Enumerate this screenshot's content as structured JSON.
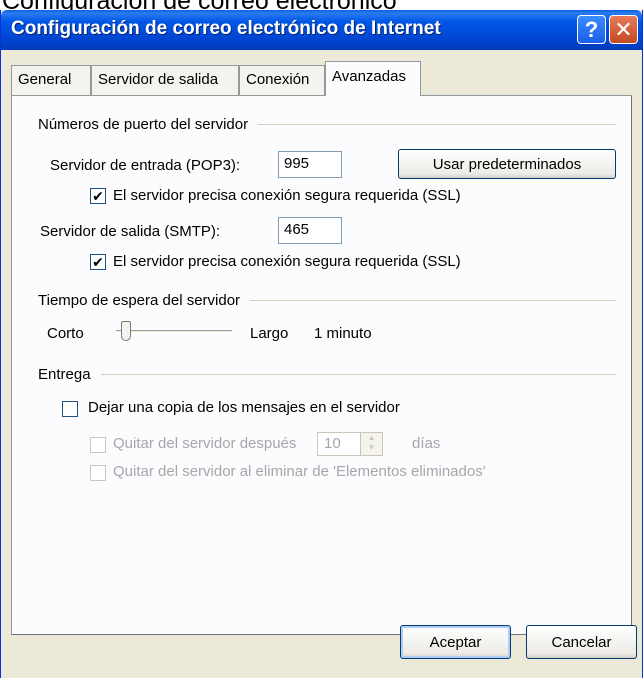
{
  "window": {
    "title": "Configuración de correo electrónico de Internet",
    "above_text": "Configuración de correo electrónico"
  },
  "tabs": [
    {
      "label": "General",
      "active": false
    },
    {
      "label": "Servidor de salida",
      "active": false
    },
    {
      "label": "Conexión",
      "active": false
    },
    {
      "label": "Avanzadas",
      "active": true
    }
  ],
  "ports": {
    "group_label": "Números de puerto del servidor",
    "incoming_label": "Servidor de entrada (POP3):",
    "incoming_value": "995",
    "defaults_button": "Usar predeterminados",
    "incoming_ssl_label": "El servidor precisa conexión segura requerida (SSL)",
    "incoming_ssl_checked": true,
    "outgoing_label": "Servidor de salida (SMTP):",
    "outgoing_value": "465",
    "outgoing_ssl_label": "El servidor precisa conexión segura requerida (SSL)",
    "outgoing_ssl_checked": true
  },
  "timeout": {
    "group_label": "Tiempo de espera del servidor",
    "short_label": "Corto",
    "long_label": "Largo",
    "value_label": "1 minuto",
    "slider_fraction": 0.05
  },
  "delivery": {
    "group_label": "Entrega",
    "leave_copy_label": "Dejar una copia de los mensajes en el servidor",
    "leave_copy_checked": false,
    "remove_after_label": "Quitar del servidor después",
    "remove_after_value": "10",
    "days_label": "días",
    "remove_deleted_label": "Quitar del servidor al eliminar de 'Elementos eliminados'"
  },
  "buttons": {
    "ok": "Aceptar",
    "cancel": "Cancelar"
  }
}
